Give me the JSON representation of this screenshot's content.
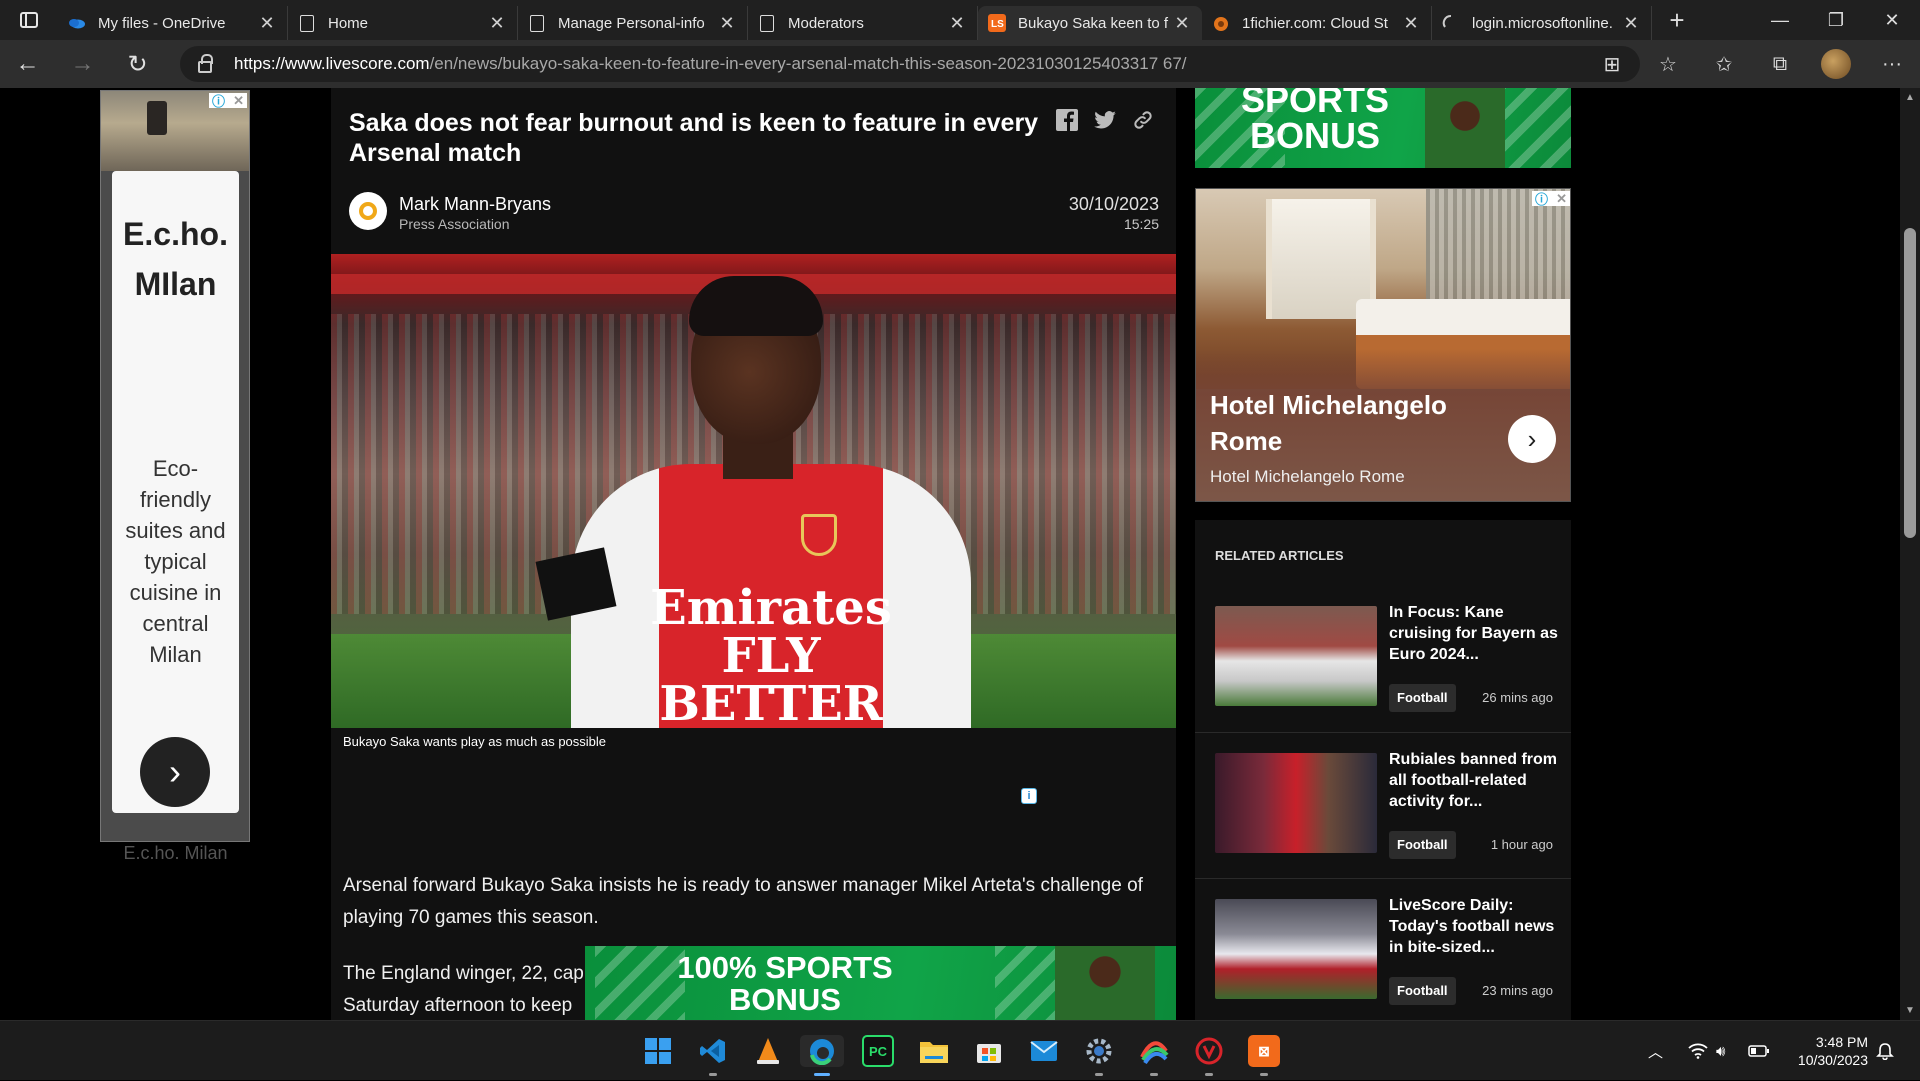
{
  "browser": {
    "tabs": [
      {
        "label": "My files - OneDrive",
        "icon": "onedrive-icon",
        "active": false
      },
      {
        "label": "Home",
        "icon": "page-icon",
        "active": false
      },
      {
        "label": "Manage Personal-info",
        "icon": "page-icon",
        "active": false
      },
      {
        "label": "Moderators",
        "icon": "page-icon",
        "active": false
      },
      {
        "label": "Bukayo Saka keen to f",
        "icon": "livescore-icon",
        "active": true
      },
      {
        "label": "1fichier.com: Cloud St",
        "icon": "1fichier-icon",
        "active": false
      },
      {
        "label": "login.microsoftonline.",
        "icon": "loading-icon",
        "active": false
      }
    ],
    "url_host": "https://www.livescore.com",
    "url_path": "/en/news/bukayo-saka-keen-to-feature-in-every-arsenal-match-this-season-20231030125403317 67/"
  },
  "article": {
    "title": "Saka does not fear burnout and is keen to feature in every Arsenal match",
    "author": "Mark Mann-Bryans",
    "organisation": "Press Association",
    "date": "30/10/2023",
    "time": "15:25",
    "caption": "Bukayo Saka wants play as much as possible",
    "sponsor_text": "Emirates FLY BETTER",
    "paragraph_1": "Arsenal forward Bukayo Saka insists he is ready to answer manager Mikel Arteta's challenge of playing 70 games this season.",
    "paragraph_2": "The England winger, 22, cap Saturday afternoon to keep"
  },
  "ads": {
    "left": {
      "name": "E.c.ho. MIlan",
      "description": "Eco-friendly suites and typical cuisine in central Milan",
      "footer": "E.c.ho. Milan"
    },
    "top_banner": {
      "line1": "SPORTS",
      "line2": "BONUS"
    },
    "hotel": {
      "name": "Hotel Michelangelo Rome",
      "subtitle": "Hotel Michelangelo Rome"
    },
    "inline_banner": {
      "line1": "100% SPORTS",
      "line2": "BONUS"
    }
  },
  "related": {
    "heading": "RELATED ARTICLES",
    "items": [
      {
        "title": "In Focus: Kane cruising for Bayern as Euro 2024...",
        "tag": "Football",
        "ago": "26 mins ago"
      },
      {
        "title": "Rubiales banned from all football-related activity for...",
        "tag": "Football",
        "ago": "1 hour ago"
      },
      {
        "title": "LiveScore Daily: Today's football news in bite-sized...",
        "tag": "Football",
        "ago": "23 mins ago"
      }
    ]
  },
  "taskbar": {
    "time": "3:48 PM",
    "date": "10/30/2023"
  },
  "colors": {
    "page_bg": "#000000",
    "panel_bg": "#111111",
    "promo_green": "#10a448",
    "arsenal_red": "#d8242a"
  }
}
